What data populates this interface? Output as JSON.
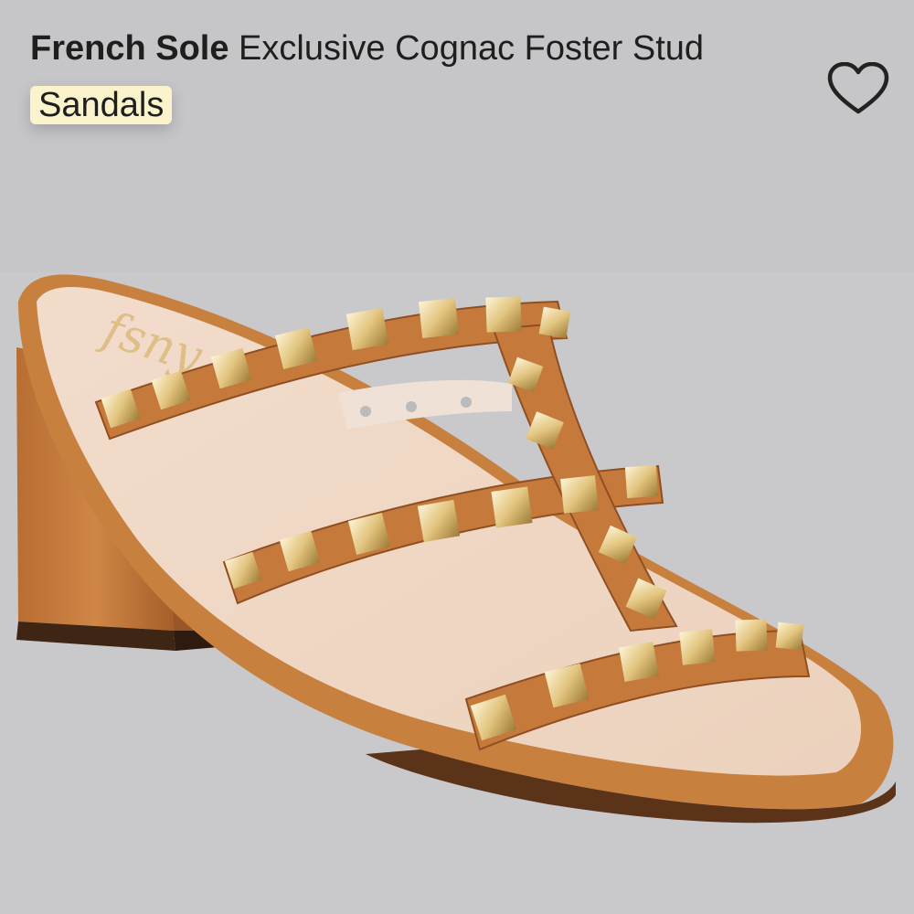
{
  "product": {
    "brand": "French Sole",
    "name_part1": " Exclusive Cognac Foster Stud",
    "name_highlight": "Sandals",
    "insole_logo": "fsny"
  },
  "icons": {
    "wishlist": "heart-outline-icon"
  },
  "colors": {
    "background": "#c9c9cb",
    "highlight": "#fbf3cc",
    "leather": "#c07a3e",
    "stud": "#e2c47e"
  }
}
